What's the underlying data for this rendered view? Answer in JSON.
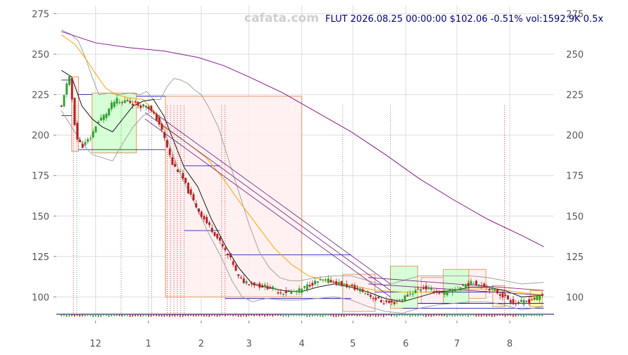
{
  "watermark": "cafata.com",
  "header": "FLUT 2026.08.25 00:00:00 $102.06 -0.51% vol:1592.9K 0.5x",
  "colors": {
    "up": "#2ca02c",
    "down": "#b22222",
    "upper_env": "#999999",
    "ma_slow": "#8b1a8b",
    "ma_mid": "#ffa500",
    "ma_fast": "#000000",
    "channel": "#7b2d8e",
    "box_green": "#ccffcc",
    "box_red": "#ffeeee",
    "box_edge": "#e69966",
    "hline": "#0000aa"
  },
  "chart_data": {
    "type": "candlestick",
    "title": "",
    "xlabel": "",
    "ylabel": "",
    "ylim": [
      88,
      280
    ],
    "y_ticks": [
      100,
      125,
      150,
      175,
      200,
      225,
      250,
      275
    ],
    "x_ticks": [
      {
        "label": "12",
        "day": 20
      },
      {
        "label": "1",
        "day": 51
      },
      {
        "label": "2",
        "day": 82
      },
      {
        "label": "3",
        "day": 110
      },
      {
        "label": "4",
        "day": 141
      },
      {
        "label": "5",
        "day": 171
      },
      {
        "label": "6",
        "day": 202
      },
      {
        "label": "7",
        "day": 232
      },
      {
        "label": "8",
        "day": 263
      }
    ],
    "x_range": [
      -3,
      289
    ],
    "grid": true,
    "close_anchors": [
      [
        0,
        217
      ],
      [
        2,
        228
      ],
      [
        5,
        236
      ],
      [
        7,
        213
      ],
      [
        9,
        198
      ],
      [
        12,
        193
      ],
      [
        15,
        196
      ],
      [
        18,
        200
      ],
      [
        20,
        206
      ],
      [
        23,
        210
      ],
      [
        26,
        213
      ],
      [
        29,
        218
      ],
      [
        32,
        222
      ],
      [
        35,
        219
      ],
      [
        38,
        222
      ],
      [
        41,
        220
      ],
      [
        44,
        219
      ],
      [
        47,
        218
      ],
      [
        50,
        219
      ],
      [
        53,
        214
      ],
      [
        57,
        208
      ],
      [
        61,
        196
      ],
      [
        65,
        182
      ],
      [
        70,
        176
      ],
      [
        75,
        164
      ],
      [
        80,
        154
      ],
      [
        85,
        146
      ],
      [
        90,
        139
      ],
      [
        95,
        130
      ],
      [
        98,
        125
      ],
      [
        101,
        120
      ],
      [
        103,
        113
      ],
      [
        106,
        110
      ],
      [
        110,
        109
      ],
      [
        116,
        107
      ],
      [
        122,
        106
      ],
      [
        128,
        103
      ],
      [
        134,
        103
      ],
      [
        140,
        104
      ],
      [
        146,
        108
      ],
      [
        152,
        110
      ],
      [
        158,
        110
      ],
      [
        164,
        108
      ],
      [
        170,
        106
      ],
      [
        176,
        104
      ],
      [
        182,
        100
      ],
      [
        188,
        97
      ],
      [
        194,
        96
      ],
      [
        200,
        99
      ],
      [
        206,
        103
      ],
      [
        212,
        106
      ],
      [
        218,
        104
      ],
      [
        224,
        102
      ],
      [
        230,
        104
      ],
      [
        236,
        107
      ],
      [
        242,
        109
      ],
      [
        248,
        107
      ],
      [
        254,
        104
      ],
      [
        260,
        100
      ],
      [
        266,
        96
      ],
      [
        272,
        97
      ],
      [
        278,
        99
      ],
      [
        283,
        102
      ]
    ],
    "ma_slow": [
      [
        0,
        264
      ],
      [
        20,
        257
      ],
      [
        40,
        254
      ],
      [
        60,
        252
      ],
      [
        80,
        248
      ],
      [
        95,
        243
      ],
      [
        110,
        236
      ],
      [
        130,
        226
      ],
      [
        150,
        214
      ],
      [
        170,
        202
      ],
      [
        190,
        188
      ],
      [
        210,
        173
      ],
      [
        230,
        160
      ],
      [
        250,
        148
      ],
      [
        270,
        138
      ],
      [
        283,
        131
      ]
    ],
    "ma_mid": [
      [
        0,
        262
      ],
      [
        8,
        256
      ],
      [
        15,
        246
      ],
      [
        20,
        238
      ],
      [
        26,
        229
      ],
      [
        32,
        225
      ],
      [
        40,
        223
      ],
      [
        48,
        222
      ],
      [
        55,
        214
      ],
      [
        60,
        205
      ],
      [
        70,
        198
      ],
      [
        85,
        186
      ],
      [
        95,
        173
      ],
      [
        105,
        158
      ],
      [
        115,
        144
      ],
      [
        125,
        130
      ],
      [
        135,
        120
      ],
      [
        145,
        113
      ],
      [
        155,
        110
      ],
      [
        165,
        108
      ],
      [
        175,
        106
      ],
      [
        185,
        104
      ],
      [
        200,
        103
      ],
      [
        215,
        103
      ],
      [
        230,
        104
      ],
      [
        245,
        105
      ],
      [
        260,
        104
      ],
      [
        275,
        102
      ],
      [
        283,
        101
      ]
    ],
    "ma_fast": [
      [
        0,
        240
      ],
      [
        6,
        236
      ],
      [
        12,
        218
      ],
      [
        18,
        210
      ],
      [
        24,
        205
      ],
      [
        30,
        202
      ],
      [
        36,
        210
      ],
      [
        42,
        218
      ],
      [
        48,
        221
      ],
      [
        54,
        222
      ],
      [
        60,
        212
      ],
      [
        66,
        196
      ],
      [
        72,
        180
      ],
      [
        80,
        168
      ],
      [
        88,
        148
      ],
      [
        96,
        132
      ],
      [
        104,
        118
      ],
      [
        112,
        108
      ],
      [
        120,
        106
      ],
      [
        130,
        104
      ],
      [
        140,
        103
      ],
      [
        150,
        106
      ],
      [
        160,
        108
      ],
      [
        170,
        106
      ],
      [
        180,
        103
      ],
      [
        190,
        99
      ],
      [
        200,
        97
      ],
      [
        210,
        100
      ],
      [
        220,
        103
      ],
      [
        230,
        104
      ],
      [
        240,
        106
      ],
      [
        250,
        106
      ],
      [
        260,
        104
      ],
      [
        270,
        100
      ],
      [
        283,
        101
      ]
    ],
    "upper_env": [
      [
        0,
        265
      ],
      [
        6,
        262
      ],
      [
        10,
        258
      ],
      [
        14,
        248
      ],
      [
        18,
        236
      ],
      [
        22,
        225
      ],
      [
        28,
        226
      ],
      [
        34,
        225
      ],
      [
        40,
        226
      ],
      [
        46,
        225
      ],
      [
        50,
        227
      ],
      [
        54,
        222
      ],
      [
        58,
        222
      ],
      [
        62,
        230
      ],
      [
        66,
        235
      ],
      [
        70,
        234
      ],
      [
        74,
        232
      ],
      [
        78,
        228
      ],
      [
        82,
        225
      ],
      [
        86,
        218
      ],
      [
        92,
        205
      ],
      [
        98,
        185
      ],
      [
        104,
        165
      ],
      [
        110,
        145
      ],
      [
        116,
        128
      ],
      [
        122,
        118
      ],
      [
        128,
        112
      ],
      [
        134,
        110
      ],
      [
        140,
        110
      ],
      [
        150,
        112
      ],
      [
        160,
        113
      ],
      [
        170,
        113
      ],
      [
        180,
        110
      ],
      [
        190,
        107
      ],
      [
        200,
        110
      ],
      [
        210,
        113
      ],
      [
        220,
        113
      ],
      [
        230,
        113
      ],
      [
        240,
        113
      ],
      [
        250,
        112
      ],
      [
        260,
        110
      ],
      [
        270,
        108
      ],
      [
        283,
        109
      ]
    ],
    "lower_env": [
      [
        0,
        215
      ],
      [
        6,
        205
      ],
      [
        12,
        195
      ],
      [
        18,
        188
      ],
      [
        24,
        186
      ],
      [
        30,
        184
      ],
      [
        36,
        195
      ],
      [
        42,
        205
      ],
      [
        48,
        212
      ],
      [
        54,
        215
      ],
      [
        58,
        210
      ],
      [
        64,
        192
      ],
      [
        70,
        175
      ],
      [
        78,
        158
      ],
      [
        86,
        140
      ],
      [
        94,
        124
      ],
      [
        100,
        110
      ],
      [
        106,
        100
      ],
      [
        112,
        97
      ],
      [
        120,
        99
      ],
      [
        130,
        98
      ],
      [
        140,
        98
      ],
      [
        150,
        99
      ],
      [
        160,
        100
      ],
      [
        170,
        98
      ],
      [
        180,
        94
      ],
      [
        190,
        91
      ],
      [
        200,
        90
      ],
      [
        210,
        93
      ],
      [
        220,
        95
      ],
      [
        230,
        96
      ],
      [
        240,
        97
      ],
      [
        250,
        97
      ],
      [
        260,
        95
      ],
      [
        270,
        92
      ],
      [
        283,
        94
      ]
    ],
    "channel_lines": [
      {
        "from": [
          49,
          214
        ],
        "to": [
          193,
          104
        ]
      },
      {
        "from": [
          49,
          210
        ],
        "to": [
          193,
          100
        ]
      },
      {
        "from": [
          49,
          218
        ],
        "to": [
          193,
          108
        ]
      },
      {
        "from": [
          180,
          112
        ],
        "to": [
          283,
          104
        ]
      },
      {
        "from": [
          180,
          108
        ],
        "to": [
          283,
          101
        ]
      }
    ],
    "boxes": [
      {
        "x0": 6,
        "x1": 10,
        "y0": 190,
        "y1": 236,
        "kind": "red"
      },
      {
        "x0": 18,
        "x1": 44,
        "y0": 189,
        "y1": 226,
        "kind": "green"
      },
      {
        "x0": 61,
        "x1": 141,
        "y0": 100,
        "y1": 224,
        "kind": "red"
      },
      {
        "x0": 165,
        "x1": 184,
        "y0": 91,
        "y1": 114,
        "kind": "red"
      },
      {
        "x0": 193,
        "x1": 209,
        "y0": 93,
        "y1": 119,
        "kind": "green"
      },
      {
        "x0": 211,
        "x1": 224,
        "y0": 96,
        "y1": 112,
        "kind": "red"
      },
      {
        "x0": 224,
        "x1": 239,
        "y0": 96,
        "y1": 117,
        "kind": "green"
      },
      {
        "x0": 239,
        "x1": 249,
        "y0": 99,
        "y1": 117,
        "kind": "red"
      },
      {
        "x0": 253,
        "x1": 260,
        "y0": 94,
        "y1": 107,
        "kind": "red"
      },
      {
        "x0": 275,
        "x1": 282,
        "y0": 94,
        "y1": 104,
        "kind": "yellow"
      }
    ],
    "h_segments": [
      {
        "x0": 0,
        "x1": 6,
        "y": 234
      },
      {
        "x0": 0,
        "x1": 6,
        "y": 212
      },
      {
        "x0": 10,
        "x1": 61,
        "y": 191
      },
      {
        "x0": 10,
        "x1": 18,
        "y": 225
      },
      {
        "x0": 44,
        "x1": 61,
        "y": 224
      },
      {
        "x0": 72,
        "x1": 93,
        "y": 181
      },
      {
        "x0": 72,
        "x1": 93,
        "y": 141
      },
      {
        "x0": 96,
        "x1": 170,
        "y": 126
      },
      {
        "x0": 96,
        "x1": 170,
        "y": 99
      },
      {
        "x0": 184,
        "x1": 260,
        "y": 103
      },
      {
        "x0": 209,
        "x1": 283,
        "y": 96
      },
      {
        "x0": 200,
        "x1": 283,
        "y": 93
      }
    ],
    "v_dotted": [
      {
        "x": 7,
        "kind": "red"
      },
      {
        "x": 9,
        "kind": "green"
      },
      {
        "x": 35,
        "kind": "green"
      },
      {
        "x": 53,
        "kind": "green"
      },
      {
        "x": 62,
        "kind": "red"
      },
      {
        "x": 64,
        "kind": "red"
      },
      {
        "x": 66,
        "kind": "red"
      },
      {
        "x": 68,
        "kind": "red"
      },
      {
        "x": 70,
        "kind": "red"
      },
      {
        "x": 72,
        "kind": "red"
      },
      {
        "x": 94,
        "kind": "red"
      },
      {
        "x": 96,
        "kind": "red"
      },
      {
        "x": 165,
        "kind": "green"
      },
      {
        "x": 193,
        "kind": "green"
      },
      {
        "x": 260,
        "kind": "red"
      }
    ]
  }
}
